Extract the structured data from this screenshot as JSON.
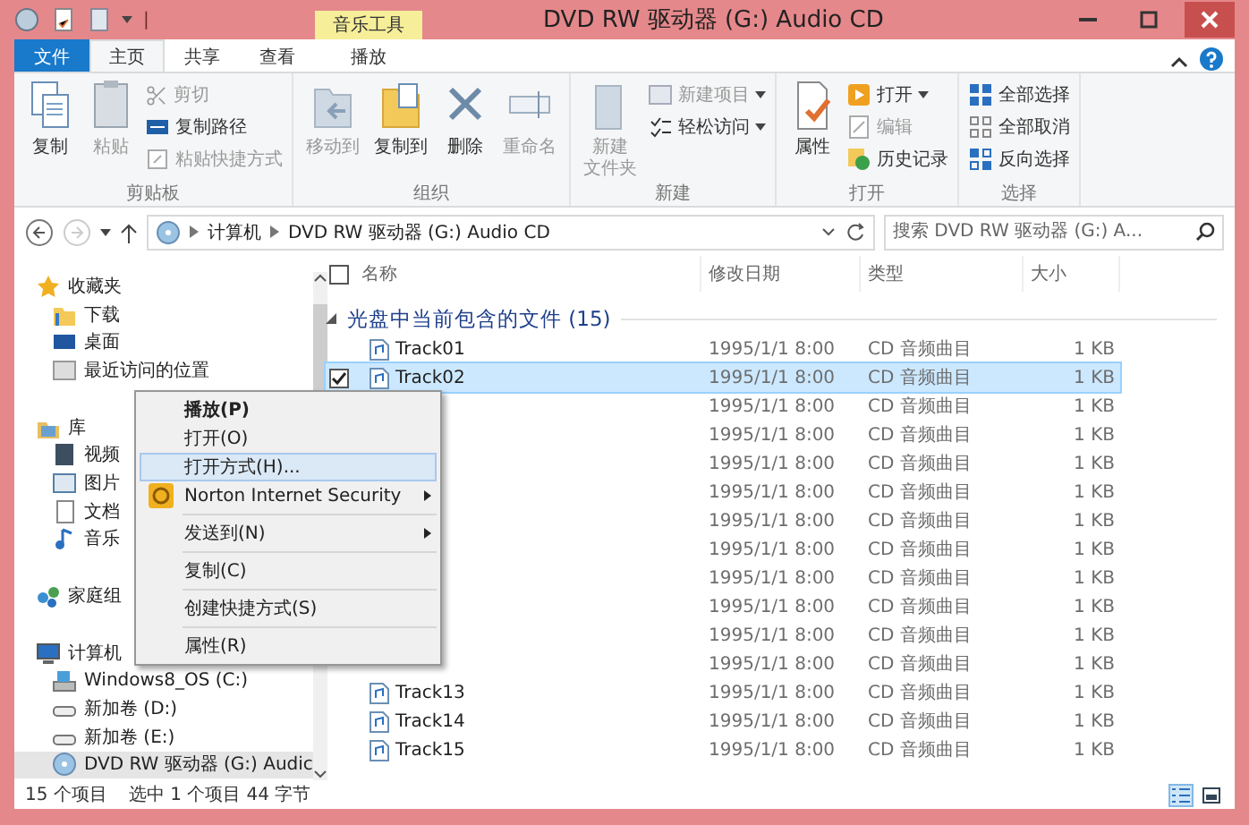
{
  "window": {
    "title": "DVD RW 驱动器 (G:) Audio CD",
    "quick_access_separator": "|"
  },
  "ribbon_tabs": [
    {
      "label": "文件",
      "kind": "file",
      "selected": false
    },
    {
      "label": "主页",
      "kind": "tab",
      "selected": true
    },
    {
      "label": "共享",
      "kind": "tab",
      "selected": false
    },
    {
      "label": "查看",
      "kind": "tab",
      "selected": false
    },
    {
      "label": "播放",
      "kind": "contextual",
      "context": "音乐工具",
      "selected": false
    }
  ],
  "ribbon_groups": [
    {
      "label": "剪贴板",
      "items": [
        {
          "label": "复制",
          "kind": "large",
          "disabled": false
        },
        {
          "label": "粘贴",
          "kind": "large",
          "disabled": true
        },
        {
          "kind": "stack",
          "items": [
            {
              "label": "剪切",
              "disabled": true
            },
            {
              "label": "复制路径",
              "disabled": false
            },
            {
              "label": "粘贴快捷方式",
              "disabled": true
            }
          ]
        }
      ]
    },
    {
      "label": "组织",
      "items": [
        {
          "label": "移动到",
          "kind": "large",
          "disabled": true
        },
        {
          "label": "复制到",
          "kind": "large",
          "disabled": false
        },
        {
          "label": "删除",
          "kind": "large",
          "disabled": false
        },
        {
          "label": "重命名",
          "kind": "large",
          "disabled": true
        }
      ]
    },
    {
      "label": "新建",
      "items": [
        {
          "label_lines": [
            "新建",
            "文件夹"
          ],
          "kind": "large",
          "disabled": true
        },
        {
          "kind": "stack",
          "items": [
            {
              "label": "新建项目",
              "disabled": true,
              "dropdown": true
            },
            {
              "label": "轻松访问",
              "disabled": false,
              "dropdown": true
            }
          ]
        }
      ]
    },
    {
      "label": "打开",
      "items": [
        {
          "label": "属性",
          "kind": "large",
          "disabled": false
        },
        {
          "kind": "stack",
          "items": [
            {
              "label": "打开",
              "disabled": false,
              "dropdown": true
            },
            {
              "label": "编辑",
              "disabled": true
            },
            {
              "label": "历史记录",
              "disabled": false
            }
          ]
        }
      ]
    },
    {
      "label": "选择",
      "items": [
        {
          "kind": "stack",
          "items": [
            {
              "label": "全部选择",
              "disabled": false
            },
            {
              "label": "全部取消",
              "disabled": false
            },
            {
              "label": "反向选择",
              "disabled": false
            }
          ]
        }
      ]
    }
  ],
  "address_bar": {
    "breadcrumb": [
      "计算机",
      "DVD RW 驱动器 (G:) Audio CD"
    ],
    "back_disabled": false,
    "forward_disabled": true
  },
  "search": {
    "placeholder": "搜索 DVD RW 驱动器 (G:) A..."
  },
  "sidebar": {
    "sections": [
      {
        "label": "收藏夹",
        "children": [
          {
            "label": "下载"
          },
          {
            "label": "桌面"
          },
          {
            "label": "最近访问的位置"
          }
        ]
      },
      {
        "label": "库",
        "children": [
          {
            "label": "视频"
          },
          {
            "label": "图片"
          },
          {
            "label": "文档"
          },
          {
            "label": "音乐"
          }
        ]
      },
      {
        "label": "家庭组"
      },
      {
        "label": "计算机",
        "children": [
          {
            "label": "Windows8_OS (C:)"
          },
          {
            "label": "新加卷 (D:)"
          },
          {
            "label": "新加卷 (E:)"
          },
          {
            "label": "DVD RW 驱动器 (G:) Audic",
            "selected": true
          }
        ]
      }
    ]
  },
  "table": {
    "select_all_checked": false,
    "columns": [
      "名称",
      "修改日期",
      "类型",
      "大小"
    ],
    "group": "光盘中当前包含的文件 (15)",
    "rows": [
      {
        "name": "Track01",
        "date": "1995/1/1 8:00",
        "type": "CD 音频曲目",
        "size": "1 KB",
        "selected": false
      },
      {
        "name": "Track02",
        "date": "1995/1/1 8:00",
        "type": "CD 音频曲目",
        "size": "1 KB",
        "selected": true
      },
      {
        "date": "1995/1/1 8:00",
        "type": "CD 音频曲目",
        "size": "1 KB",
        "selected": false
      },
      {
        "date": "1995/1/1 8:00",
        "type": "CD 音频曲目",
        "size": "1 KB",
        "selected": false
      },
      {
        "date": "1995/1/1 8:00",
        "type": "CD 音频曲目",
        "size": "1 KB",
        "selected": false
      },
      {
        "date": "1995/1/1 8:00",
        "type": "CD 音频曲目",
        "size": "1 KB",
        "selected": false
      },
      {
        "date": "1995/1/1 8:00",
        "type": "CD 音频曲目",
        "size": "1 KB",
        "selected": false
      },
      {
        "date": "1995/1/1 8:00",
        "type": "CD 音频曲目",
        "size": "1 KB",
        "selected": false
      },
      {
        "date": "1995/1/1 8:00",
        "type": "CD 音频曲目",
        "size": "1 KB",
        "selected": false
      },
      {
        "date": "1995/1/1 8:00",
        "type": "CD 音频曲目",
        "size": "1 KB",
        "selected": false
      },
      {
        "date": "1995/1/1 8:00",
        "type": "CD 音频曲目",
        "size": "1 KB",
        "selected": false
      },
      {
        "date": "1995/1/1 8:00",
        "type": "CD 音频曲目",
        "size": "1 KB",
        "selected": false
      },
      {
        "name": "Track13",
        "date": "1995/1/1 8:00",
        "type": "CD 音频曲目",
        "size": "1 KB",
        "selected": false
      },
      {
        "name": "Track14",
        "date": "1995/1/1 8:00",
        "type": "CD 音频曲目",
        "size": "1 KB",
        "selected": false
      },
      {
        "name": "Track15",
        "date": "1995/1/1 8:00",
        "type": "CD 音频曲目",
        "size": "1 KB",
        "selected": false
      }
    ]
  },
  "context_menu": [
    {
      "label": "播放(P)",
      "kind": "item",
      "default": true,
      "selected": false
    },
    {
      "label": "打开(O)",
      "kind": "item",
      "default": false,
      "selected": false
    },
    {
      "label": "打开方式(H)...",
      "kind": "item",
      "default": false,
      "selected": true
    },
    {
      "label": "Norton Internet Security",
      "kind": "app",
      "default": false,
      "selected": false,
      "submenu": true
    },
    {
      "kind": "separator"
    },
    {
      "label": "发送到(N)",
      "kind": "item",
      "default": false,
      "selected": false,
      "submenu": true
    },
    {
      "kind": "separator"
    },
    {
      "label": "复制(C)",
      "kind": "item",
      "default": false,
      "selected": false
    },
    {
      "kind": "separator"
    },
    {
      "label": "创建快捷方式(S)",
      "kind": "item",
      "default": false,
      "selected": false
    },
    {
      "kind": "separator"
    },
    {
      "label": "属性(R)",
      "kind": "item",
      "default": false,
      "selected": false
    }
  ],
  "status_bar": {
    "count": "15 个项目",
    "selection": "选中 1 个项目 44 字节",
    "view_buttons": [
      {
        "kind": "details",
        "selected": true
      },
      {
        "kind": "thumbnails",
        "selected": false
      }
    ]
  }
}
